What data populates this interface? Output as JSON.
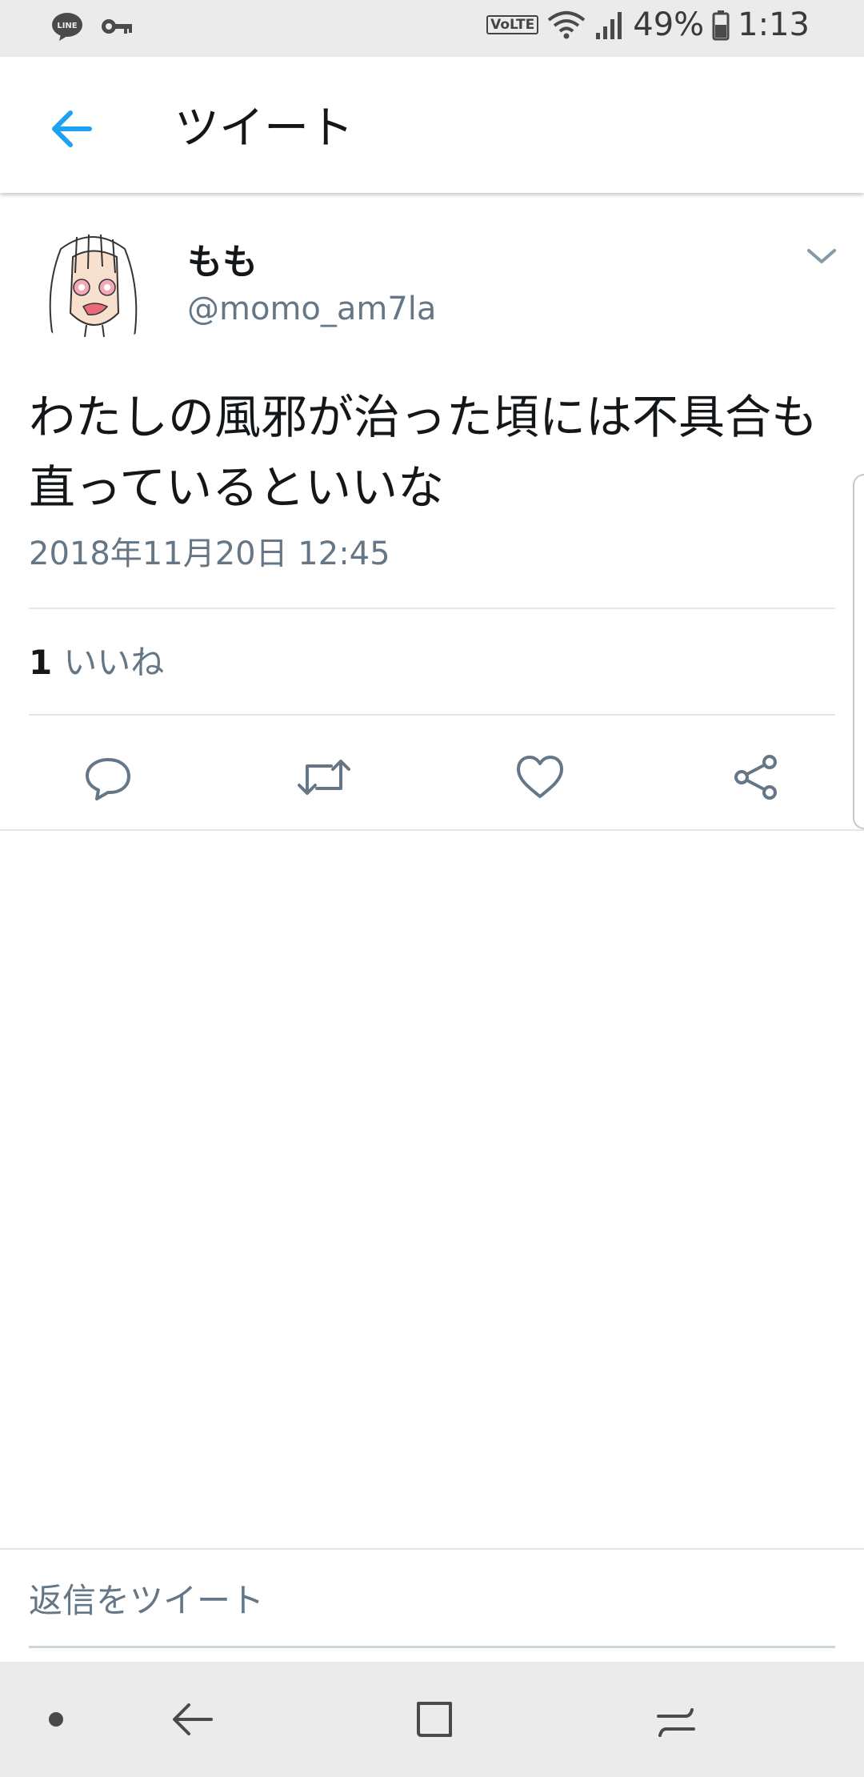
{
  "status_bar": {
    "left_icons": [
      "line-icon",
      "key-icon"
    ],
    "volte": "VoLTE",
    "battery_percent": "49%",
    "time": "1:13"
  },
  "app_bar": {
    "title": "ツイート",
    "back_icon": "arrow-left-icon"
  },
  "tweet": {
    "author": {
      "name": "もも",
      "handle": "@momo_am7la"
    },
    "text": "わたしの風邪が治った頃には不具合も直っているといいな",
    "timestamp": "2018年11月20日 12:45",
    "likes": {
      "count": "1",
      "label": "いいね"
    },
    "actions": [
      "reply-icon",
      "retweet-icon",
      "like-icon",
      "share-icon"
    ]
  },
  "reply": {
    "placeholder": "返信をツイート"
  },
  "colors": {
    "accent": "#1da1f2",
    "text_primary": "#14171a",
    "text_secondary": "#657786",
    "divider": "#e1e8ed",
    "status_bar_bg": "#ebebeb"
  }
}
